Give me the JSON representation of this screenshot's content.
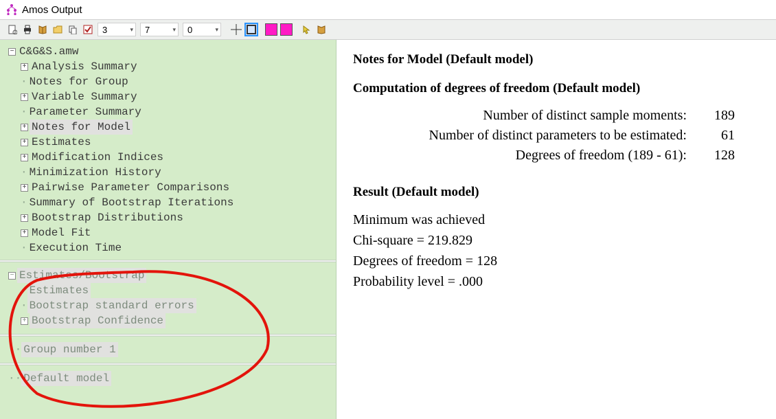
{
  "window": {
    "title": "Amos Output"
  },
  "toolbar": {
    "spin1": "3",
    "spin2": "7",
    "spin3": "0"
  },
  "tree": {
    "root": "C&G&S.amw",
    "items": [
      {
        "label": "Analysis Summary",
        "exp": "+"
      },
      {
        "label": "Notes for Group",
        "exp": ""
      },
      {
        "label": "Variable Summary",
        "exp": "+"
      },
      {
        "label": "Parameter Summary",
        "exp": ""
      },
      {
        "label": "Notes for Model",
        "exp": "+",
        "hl": true
      },
      {
        "label": "Estimates",
        "exp": "+"
      },
      {
        "label": "Modification Indices",
        "exp": "+"
      },
      {
        "label": "Minimization History",
        "exp": ""
      },
      {
        "label": "Pairwise Parameter Comparisons",
        "exp": "+"
      },
      {
        "label": "Summary of Bootstrap Iterations",
        "exp": ""
      },
      {
        "label": "Bootstrap Distributions",
        "exp": "+"
      },
      {
        "label": "Model Fit",
        "exp": "+"
      },
      {
        "label": "Execution Time",
        "exp": ""
      }
    ]
  },
  "estimates_panel": {
    "root": "Estimates/Bootstrap",
    "children": [
      {
        "label": "Estimates",
        "exp": ""
      },
      {
        "label": "Bootstrap standard errors",
        "exp": ""
      },
      {
        "label": "Bootstrap Confidence",
        "exp": "+"
      }
    ]
  },
  "group_panel": {
    "label": "Group number 1"
  },
  "model_panel": {
    "label": "Default model"
  },
  "content": {
    "heading1": "Notes for Model (Default model)",
    "heading2": "Computation of degrees of freedom (Default model)",
    "dof_rows": [
      {
        "label": "Number of distinct sample moments:",
        "value": "189"
      },
      {
        "label": "Number of distinct parameters to be estimated:",
        "value": "61"
      },
      {
        "label": "Degrees of freedom (189 - 61):",
        "value": "128"
      }
    ],
    "heading3": "Result (Default model)",
    "result_lines": [
      "Minimum was achieved",
      "Chi-square = 219.829",
      "Degrees of freedom = 128",
      "Probability level = .000"
    ]
  }
}
